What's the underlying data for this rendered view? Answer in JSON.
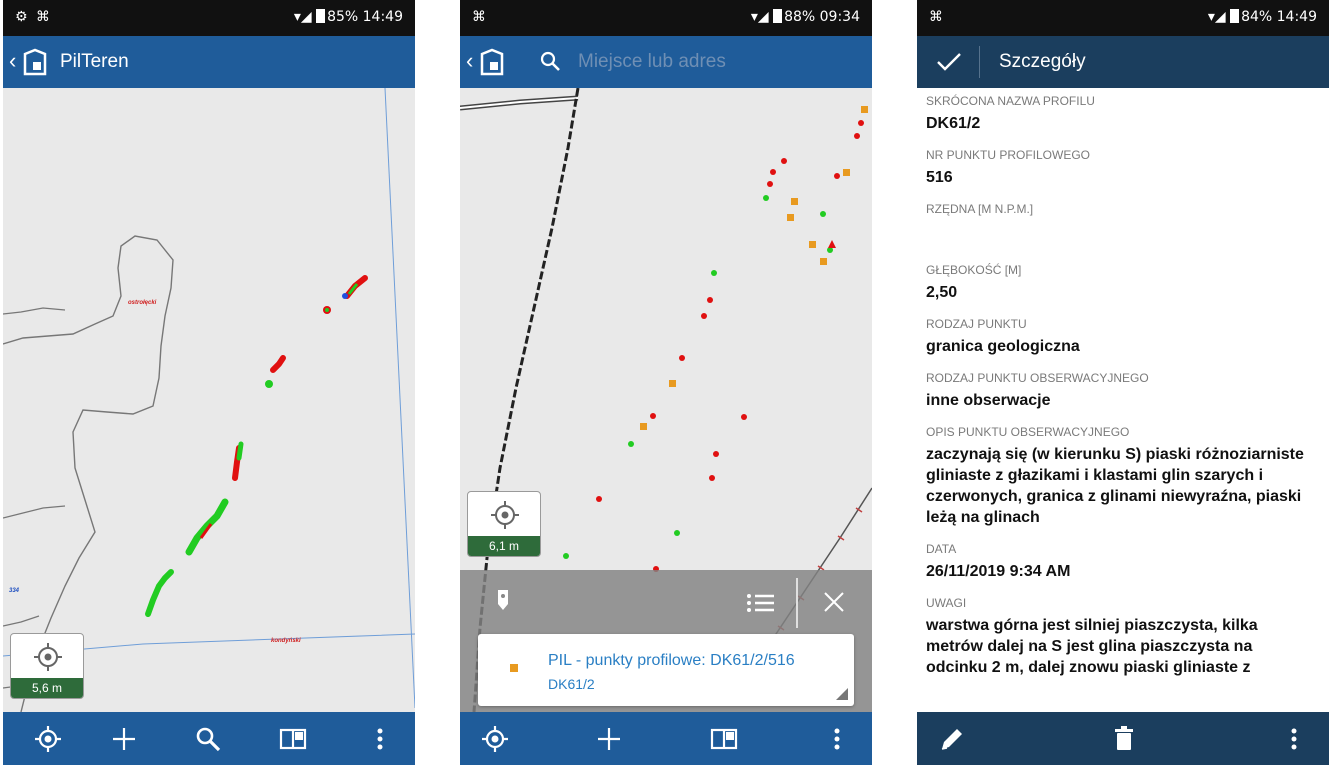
{
  "screen1": {
    "status": {
      "left_icons": "⚙ ⌘",
      "right_text": "85%  14:49"
    },
    "appbar": {
      "back": "‹",
      "title": "PilTeren"
    },
    "map": {
      "labels": {
        "ostroleka": "ostrołęcki",
        "kmdyniski": "kondyński",
        "road": "334"
      }
    },
    "location": {
      "distance": "5,6 m",
      "icon": "crosshair-icon"
    },
    "bottombar": [
      "locate-icon",
      "add-icon",
      "search-icon",
      "map-icon",
      "more-icon"
    ]
  },
  "screen2": {
    "status": {
      "left_icons": "⌘",
      "right_text": "88%  09:34"
    },
    "appbar": {
      "back": "‹",
      "search_placeholder": "Miejsce lub adres"
    },
    "location": {
      "distance": "6,1 m"
    },
    "result": {
      "title": "PIL - punkty profilowe: DK61/2/516",
      "subtitle": "DK61/2"
    },
    "bottombar": [
      "locate-icon",
      "add-icon",
      "map-icon",
      "more-icon"
    ]
  },
  "screen3": {
    "status": {
      "left_icons": "⌘",
      "right_text": "84%  14:49"
    },
    "appbar": {
      "title": "Szczegóły"
    },
    "fields": [
      {
        "label": "SKRÓCONA NAZWA PROFILU",
        "value": "DK61/2"
      },
      {
        "label": "NR PUNKTU PROFILOWEGO",
        "value": "516"
      },
      {
        "label": "RZĘDNA [M N.P.M.]",
        "value": ""
      },
      {
        "label": "GŁĘBOKOŚĆ [M]",
        "value": "2,50"
      },
      {
        "label": "RODZAJ PUNKTU",
        "value": "granica geologiczna"
      },
      {
        "label": "RODZAJ PUNKTU OBSERWACYJNEGO",
        "value": "inne obserwacje"
      },
      {
        "label": "OPIS PUNKTU OBSERWACYJNEGO",
        "value": "zaczynają się (w kierunku S) piaski różnoziarniste gliniaste z głazikami i klastami glin szarych i czerwonych, granica z glinami niewyraźna, piaski leżą na glinach"
      },
      {
        "label": "DATA",
        "value": "26/11/2019 9:34 AM"
      },
      {
        "label": "UWAGI",
        "value": "warstwa górna jest silniej piaszczysta, kilka metrów dalej na S jest glina piaszczysta na odcinku 2 m, dalej znowu piaski gliniaste z"
      }
    ],
    "bottombar": [
      "edit-icon",
      "delete-icon",
      "more-icon"
    ]
  },
  "colors": {
    "appbar": "#1f5c9a",
    "appbar_dark": "#1b3e5e",
    "point_red": "#e01010",
    "point_green": "#22cc22",
    "point_orange": "#e89a20",
    "accuracy_green": "#2e6b3a"
  }
}
